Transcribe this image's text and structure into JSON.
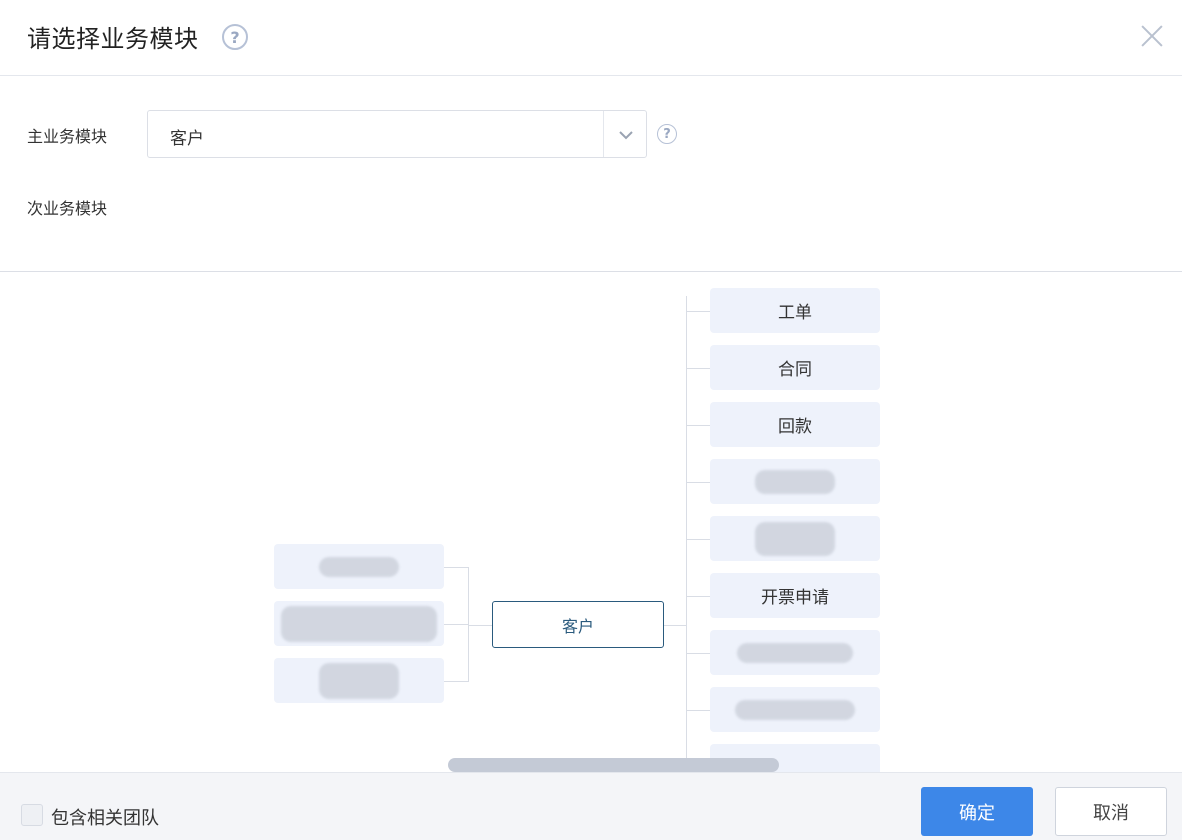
{
  "dialog": {
    "title": "请选择业务模块",
    "help_glyph": "?"
  },
  "form": {
    "main_label": "主业务模块",
    "main_value": "客户",
    "help_glyph": "?",
    "sub_label": "次业务模块"
  },
  "mindmap": {
    "center": "客户",
    "right_nodes": [
      {
        "label": "工单",
        "blurred": false
      },
      {
        "label": "合同",
        "blurred": false
      },
      {
        "label": "回款",
        "blurred": false
      },
      {
        "label": "",
        "blurred": true
      },
      {
        "label": "",
        "blurred": true
      },
      {
        "label": "开票申请",
        "blurred": false
      },
      {
        "label": "",
        "blurred": true
      },
      {
        "label": "",
        "blurred": true
      },
      {
        "label": "",
        "blurred": false
      }
    ],
    "left_nodes": [
      {
        "label": "",
        "blurred": true
      },
      {
        "label": "",
        "blurred": true
      },
      {
        "label": "",
        "blurred": true
      }
    ]
  },
  "footer": {
    "include_team_label": "包含相关团队",
    "include_team_checked": false,
    "confirm_label": "确定",
    "cancel_label": "取消"
  },
  "colors": {
    "primary": "#3d87e8",
    "node_bg": "#eef2fb",
    "center_border": "#2a5a7d"
  },
  "icons": [
    "question-circle-icon",
    "close-icon",
    "chevron-down-icon"
  ]
}
